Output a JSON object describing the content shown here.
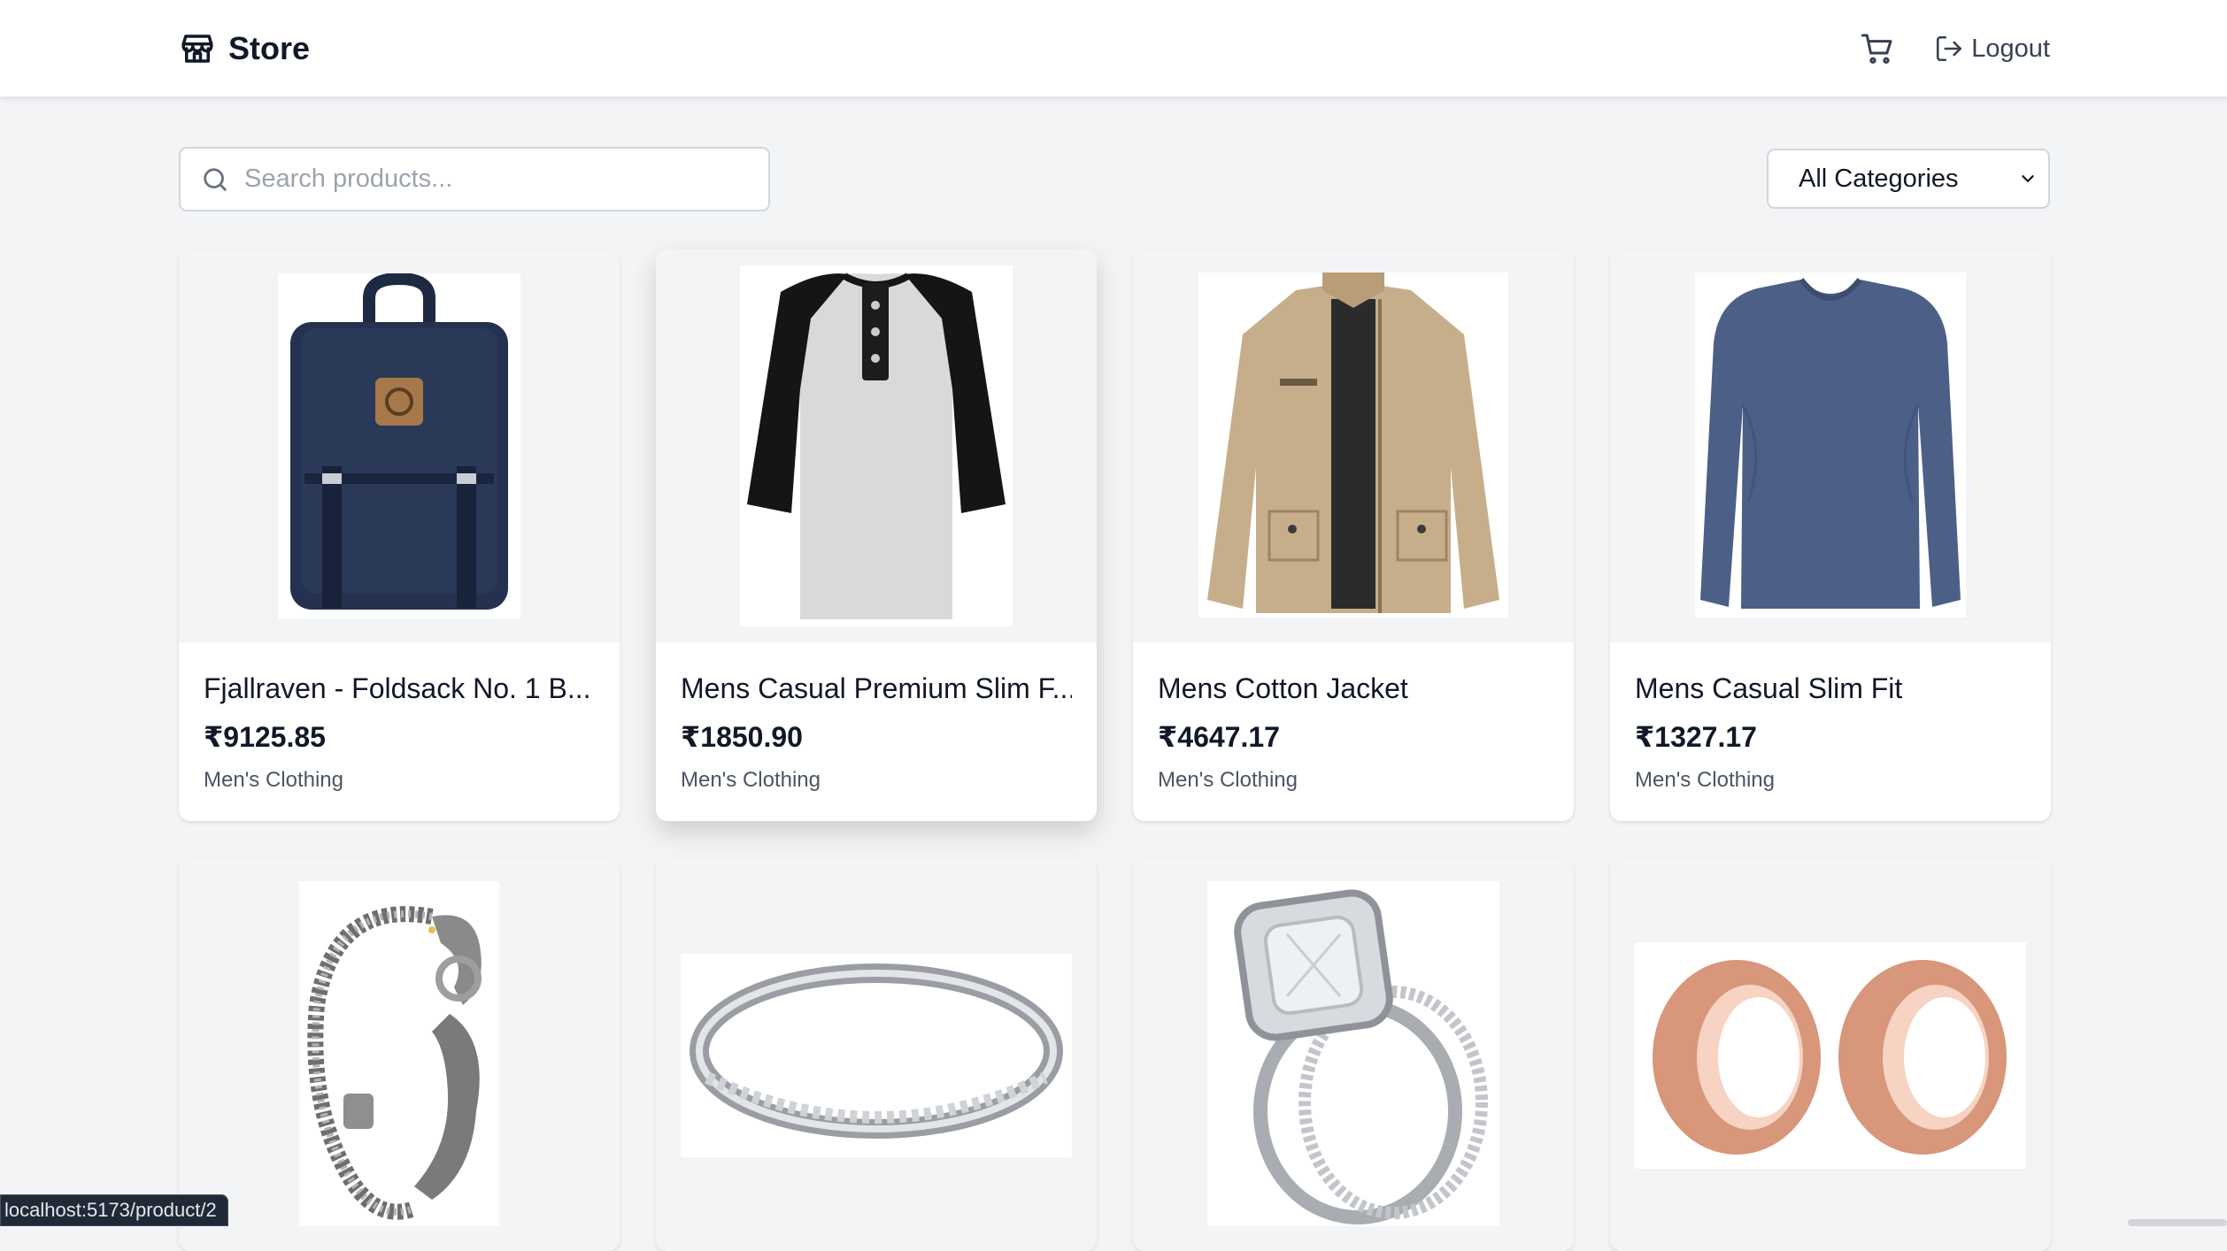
{
  "header": {
    "brand": "Store",
    "logout_label": "Logout"
  },
  "search": {
    "placeholder": "Search products...",
    "value": ""
  },
  "filter": {
    "selected": "All Categories"
  },
  "products": [
    {
      "title": "Fjallraven - Foldsack No. 1 B...",
      "price": "₹9125.85",
      "category": "Men's Clothing",
      "icon": "backpack-image"
    },
    {
      "title": "Mens Casual Premium Slim F...",
      "price": "₹1850.90",
      "category": "Men's Clothing",
      "icon": "raglan-tshirt-image"
    },
    {
      "title": "Mens Cotton Jacket",
      "price": "₹4647.17",
      "category": "Men's Clothing",
      "icon": "cotton-jacket-image"
    },
    {
      "title": "Mens Casual Slim Fit",
      "price": "₹1327.17",
      "category": "Men's Clothing",
      "icon": "slim-fit-shirt-image"
    },
    {
      "icon": "dragon-bracelet-image"
    },
    {
      "icon": "silver-ring-image"
    },
    {
      "icon": "diamond-ring-image"
    },
    {
      "icon": "rose-gold-plugs-image"
    }
  ],
  "status_bar": {
    "link": "localhost:5173/product/2"
  },
  "colors": {
    "page_bg": "#f3f4f6",
    "card_bg": "#ffffff",
    "text_primary": "#111827",
    "text_secondary": "#4b5563",
    "border": "#d1d5db"
  }
}
